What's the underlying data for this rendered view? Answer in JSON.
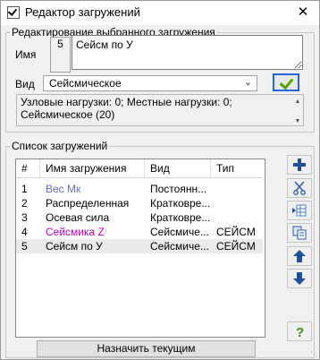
{
  "window": {
    "title": "Редактор загружений",
    "close_glyph": "✕"
  },
  "edit_group": {
    "legend": "Редактирование выбранного загружения",
    "name_label": "Имя",
    "number": "5",
    "name_value": "Сейсм по У",
    "type_label": "Вид",
    "type_value": "Сейсмическое",
    "info_line1": "Узловые нагрузки:  0;  Местные нагрузки:  0;",
    "info_line2": "Сейсмическое  (20)"
  },
  "list_group": {
    "legend": "Список загружений",
    "columns": [
      "#",
      "Имя загружения",
      "Вид",
      "Тип"
    ],
    "rows": [
      {
        "num": "1",
        "name": "Вес Мк",
        "kind": "Постоянн...",
        "type": "",
        "color": "#6d6db8"
      },
      {
        "num": "2",
        "name": "Распределенная",
        "kind": "Кратковре...",
        "type": "",
        "color": "#000000"
      },
      {
        "num": "3",
        "name": "Осевая сила",
        "kind": "Кратковре...",
        "type": "",
        "color": "#000000"
      },
      {
        "num": "4",
        "name": "Сейсмика Z",
        "kind": "Сейсмиче...",
        "type": "СЕЙСМ",
        "color": "#c000c0"
      },
      {
        "num": "5",
        "name": "Сейсм по У",
        "kind": "Сейсмиче...",
        "type": "СЕЙСМ",
        "color": "#000000"
      }
    ]
  },
  "side_buttons": [
    {
      "icon": "plus-icon"
    },
    {
      "icon": "scissors-icon"
    },
    {
      "icon": "insert-row-icon"
    },
    {
      "icon": "copy-icon"
    },
    {
      "icon": "arrow-up-icon"
    },
    {
      "icon": "arrow-down-icon"
    },
    {
      "icon": "help-icon"
    }
  ],
  "assign_button": "Назначить текущим",
  "colors": {
    "accent": "#2465d8",
    "check": "#4fa300",
    "icon_blue": "#1f4f9e"
  }
}
